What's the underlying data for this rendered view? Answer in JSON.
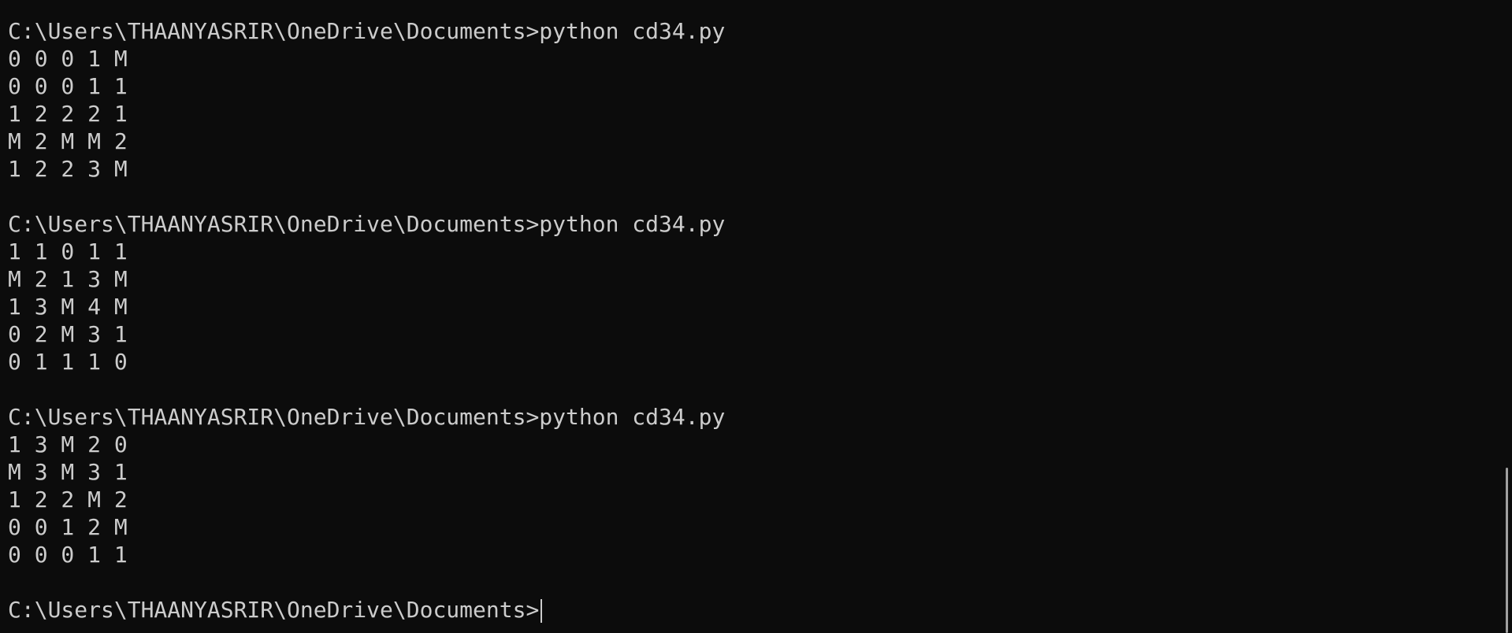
{
  "terminal": {
    "runs": [
      {
        "prompt": "C:\\Users\\THAANYASRIR\\OneDrive\\Documents>",
        "command": "python cd34.py",
        "output": [
          "0 0 0 1 M",
          "0 0 0 1 1",
          "1 2 2 2 1",
          "M 2 M M 2",
          "1 2 2 3 M"
        ]
      },
      {
        "prompt": "C:\\Users\\THAANYASRIR\\OneDrive\\Documents>",
        "command": "python cd34.py",
        "output": [
          "1 1 0 1 1",
          "M 2 1 3 M",
          "1 3 M 4 M",
          "0 2 M 3 1",
          "0 1 1 1 0"
        ]
      },
      {
        "prompt": "C:\\Users\\THAANYASRIR\\OneDrive\\Documents>",
        "command": "python cd34.py",
        "output": [
          "1 3 M 2 0",
          "M 3 M 3 1",
          "1 2 2 M 2",
          "0 0 1 2 M",
          "0 0 0 1 1"
        ]
      }
    ],
    "current_prompt": "C:\\Users\\THAANYASRIR\\OneDrive\\Documents>"
  },
  "colors": {
    "background": "#0c0c0c",
    "text": "#cccccc",
    "scrollbar_thumb": "#a0a0a0"
  }
}
